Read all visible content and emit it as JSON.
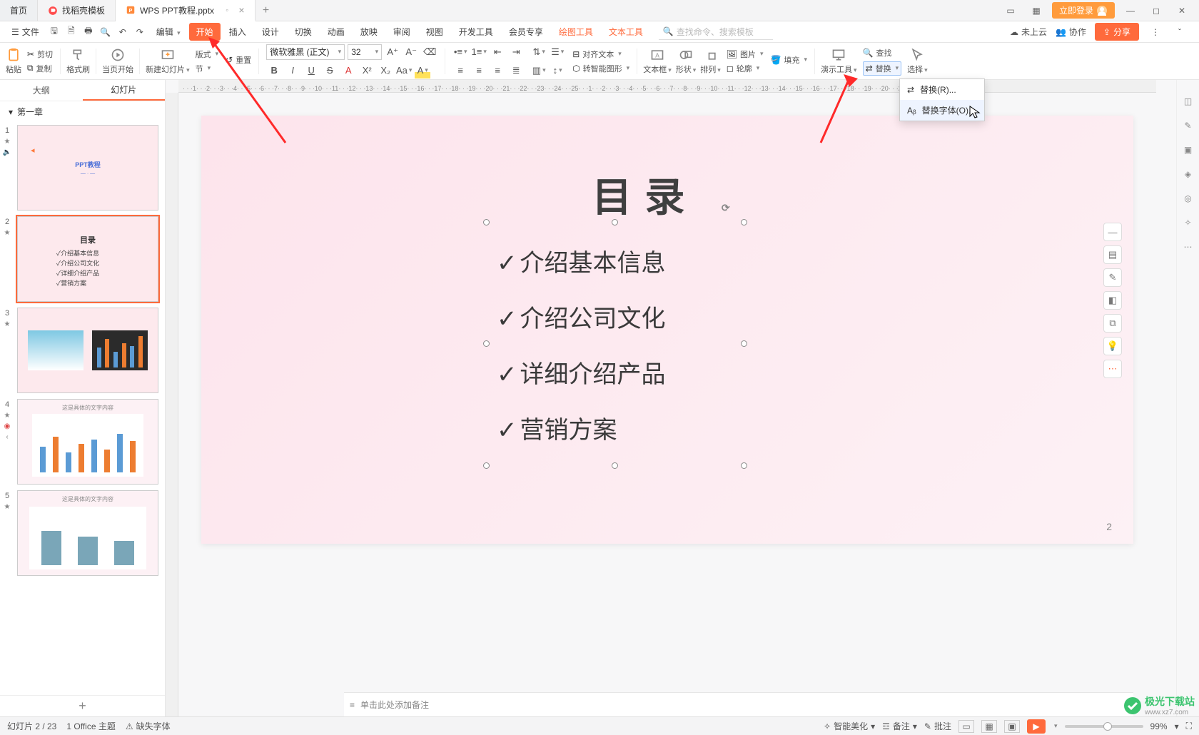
{
  "tabs": {
    "home": "首页",
    "template": "找稻壳模板",
    "file": "WPS PPT教程.pptx"
  },
  "title_right": {
    "login": "立即登录"
  },
  "menubar": {
    "file": "文件",
    "edit": "编辑",
    "items": [
      "开始",
      "插入",
      "设计",
      "切换",
      "动画",
      "放映",
      "审阅",
      "视图",
      "开发工具",
      "会员专享"
    ],
    "tool1": "绘图工具",
    "tool2": "文本工具",
    "search_ph": "查找命令、搜索模板",
    "cloud": "未上云",
    "coop": "协作",
    "share": "分享"
  },
  "ribbon": {
    "paste": "粘贴",
    "cut": "剪切",
    "copy": "复制",
    "format_painter": "格式刷",
    "from_current": "当页开始",
    "new_slide": "新建幻灯片",
    "layout": "版式",
    "section": "节",
    "reset": "重置",
    "font_name": "微软雅黑 (正文)",
    "font_size": "32",
    "textbox": "文本框",
    "shape": "形状",
    "arrange": "排列",
    "picture": "图片",
    "outline": "轮廓",
    "fill": "填充",
    "align_text": "对齐文本",
    "smartart": "转智能图形",
    "presenter": "演示工具",
    "find": "查找",
    "replace": "替换",
    "select": "选择"
  },
  "dropdown": {
    "replace": "替换(R)...",
    "replace_font": "替换字体(O)..."
  },
  "side": {
    "tab_outline": "大纲",
    "tab_slides": "幻灯片",
    "chapter": "第一章"
  },
  "slide": {
    "title": "目录",
    "items": [
      "介绍基本信息",
      "介绍公司文化",
      "详细介绍产品",
      "营销方案"
    ],
    "page_num": "2"
  },
  "thumbs": {
    "t1_title": "PPT教程",
    "t2_title": "目录",
    "t2_items": [
      "✓介绍基本信息",
      "✓介绍公司文化",
      "✓详细介绍产品",
      "✓营销方案"
    ]
  },
  "notes": {
    "placeholder": "单击此处添加备注"
  },
  "status": {
    "slide_pos": "幻灯片 2 / 23",
    "theme": "1 Office 主题",
    "missing_font": "缺失字体",
    "beautify": "智能美化",
    "notes": "备注",
    "comments": "批注",
    "zoom": "99%"
  },
  "ruler_h": "· · ·1· · ·2· · ·3· · ·4· · ·5· · ·6· · ·7· · ·8· · ·9· · ·10· · ·11· · ·12· · ·13· · ·14· · ·15· · ·16· · ·17· · ·18· · ·19· · ·20· · ·21· · ·22· · ·23· · ·24· · ·25· · ·1· · ·2· · ·3· · ·4· · ·5· · ·6· · ·7· · ·8· · ·9· · ·10· · ·11· · ·12· · ·13· · ·14· · ·15· · ·16· · ·17· · ·18· · ·19· · ·20· · ·21",
  "watermark": {
    "name": "极光下载站",
    "url": "www.xz7.com"
  }
}
